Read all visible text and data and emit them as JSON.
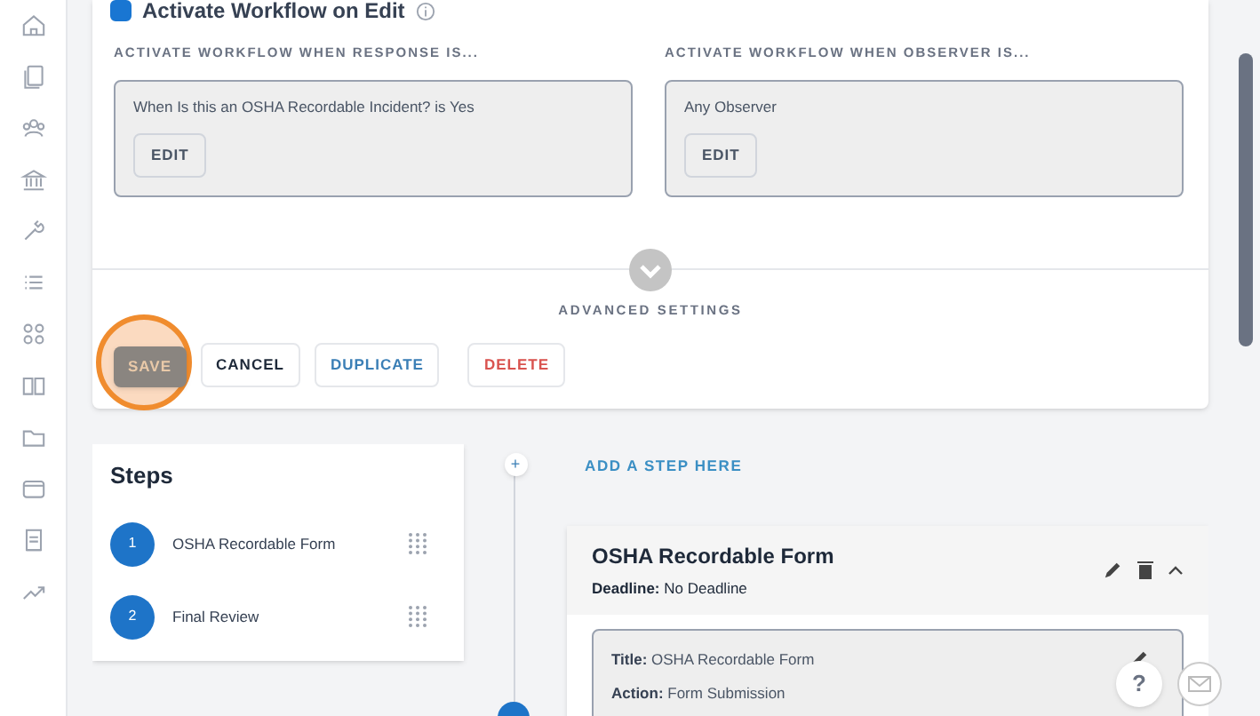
{
  "edit_toggle": {
    "label": "Activate Workflow on Edit",
    "checked": true
  },
  "conditions": [
    {
      "heading": "ACTIVATE WORKFLOW WHEN RESPONSE IS...",
      "text": "When Is this an OSHA Recordable Incident? is Yes",
      "button": "EDIT"
    },
    {
      "heading": "ACTIVATE WORKFLOW WHEN OBSERVER IS...",
      "text": "Any Observer",
      "button": "EDIT"
    }
  ],
  "advanced_settings": {
    "label": "ADVANCED SETTINGS",
    "expanded": false
  },
  "actions": [
    {
      "label": "SAVE",
      "kind": "primary",
      "highlighted": true
    },
    {
      "label": "CANCEL",
      "kind": "plain",
      "highlighted": false
    },
    {
      "label": "DUPLICATE",
      "kind": "info",
      "highlighted": false
    },
    {
      "label": "DELETE",
      "kind": "danger",
      "highlighted": false
    }
  ],
  "steps": {
    "title": "Steps",
    "items": [
      {
        "number": "1",
        "label": "OSHA Recordable Form"
      },
      {
        "number": "2",
        "label": "Final Review"
      }
    ]
  },
  "timeline": {
    "add_button": "+",
    "add_link": "ADD A STEP HERE"
  },
  "step_card": {
    "title": "OSHA Recordable Form",
    "deadline_label": "Deadline:",
    "deadline_value": "No Deadline",
    "expanded": true,
    "fields": [
      {
        "label": "Title:",
        "value": "OSHA Recordable Form"
      },
      {
        "label": "Action:",
        "value": "Form Submission"
      }
    ]
  },
  "help_button": "?"
}
